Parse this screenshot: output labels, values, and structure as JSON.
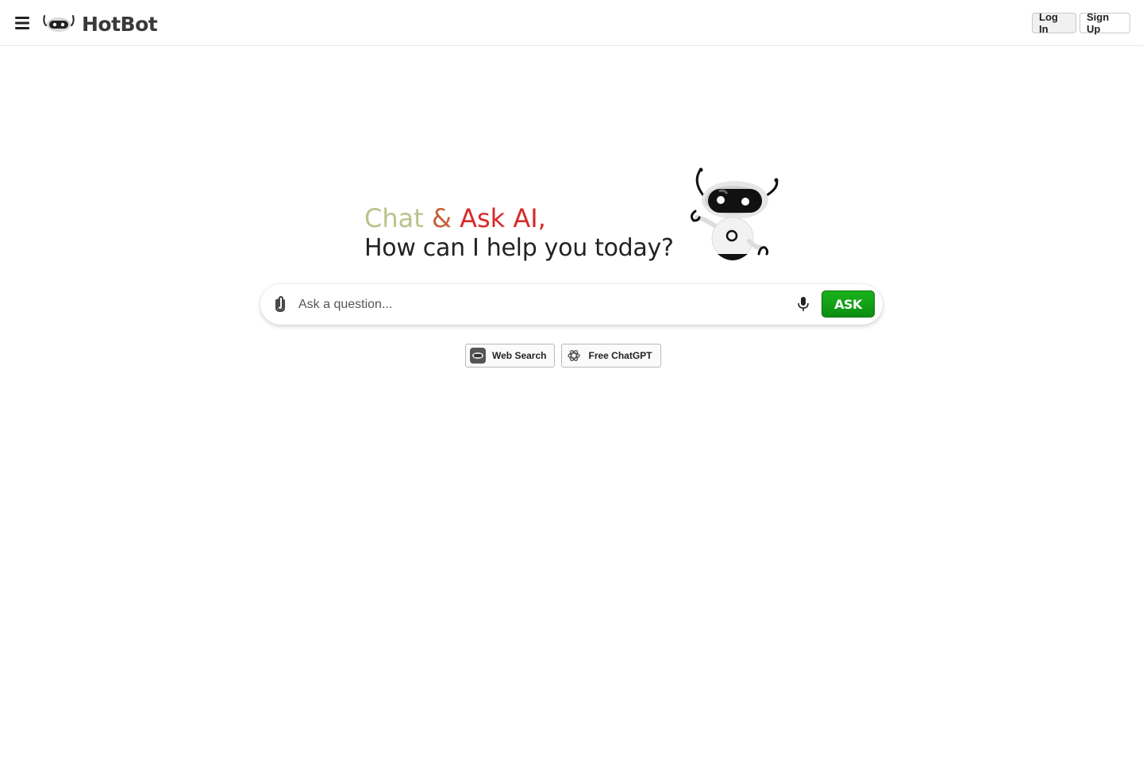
{
  "header": {
    "logo_text": "HotBot",
    "menu_icon": "hamburger-menu-icon",
    "login_label": "Log In",
    "signup_label": "Sign Up"
  },
  "hero": {
    "line1_part1": "Chat",
    "line1_part2": " & ",
    "line1_part3": "Ask AI,",
    "line2": "How can I help you today?",
    "mascot": "robot-mascot"
  },
  "search": {
    "placeholder": "Ask a question...",
    "value": "",
    "attach_icon": "paperclip-icon",
    "mic_icon": "microphone-icon",
    "ask_label": "ASK"
  },
  "chips": [
    {
      "label": "Web Search",
      "icon": "robot-eye-icon"
    },
    {
      "label": "Free ChatGPT",
      "icon": "openai-icon"
    }
  ],
  "colors": {
    "accent_green": "#13a317",
    "title_gradient_start": "#b7c48a",
    "title_gradient_mid": "#c6603a",
    "title_gradient_end": "#d82a2a"
  }
}
